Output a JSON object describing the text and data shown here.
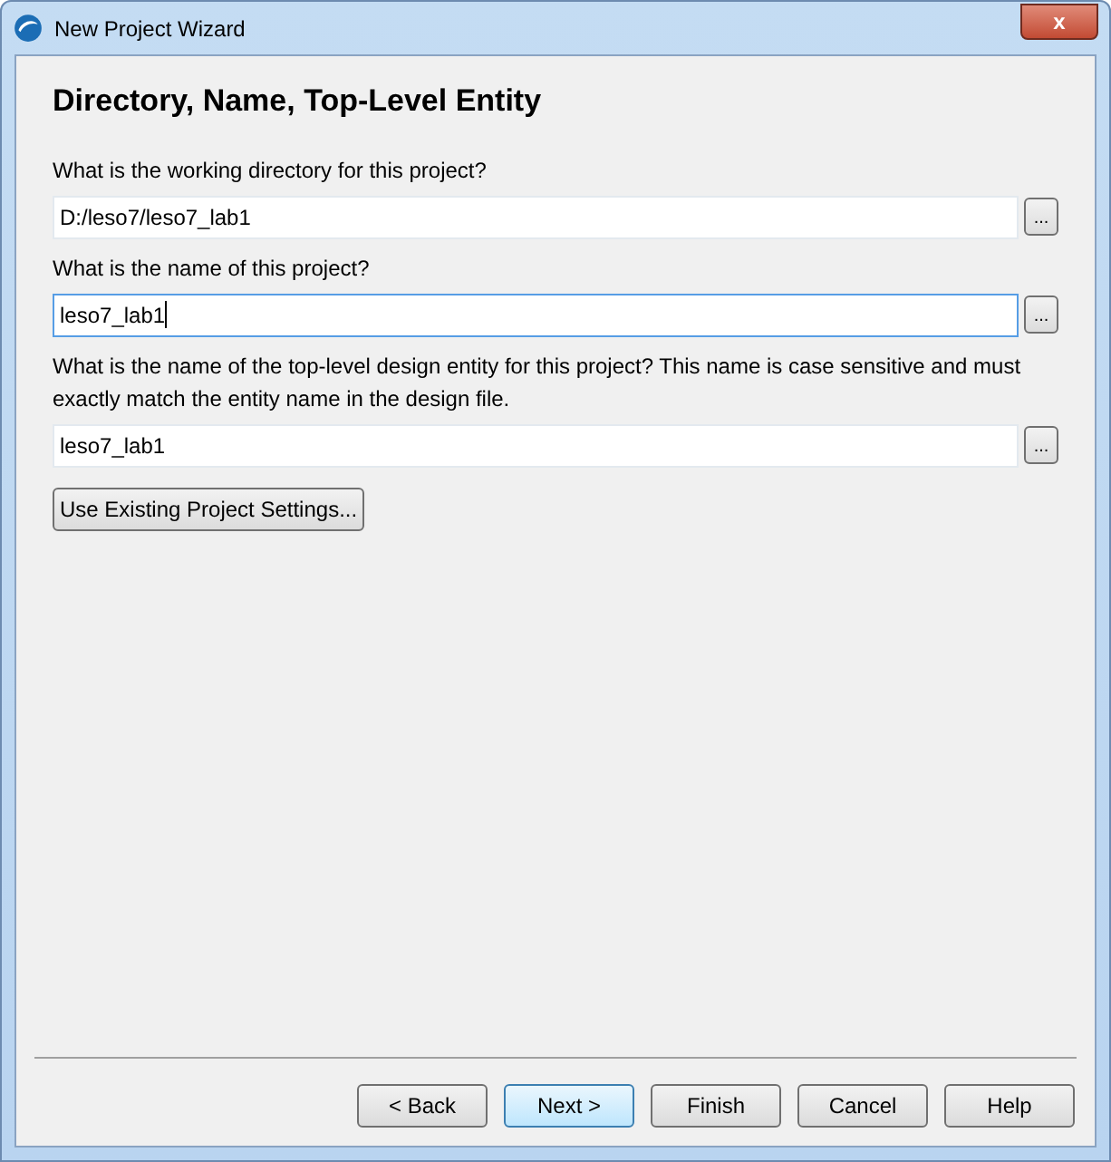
{
  "window": {
    "title": "New Project Wizard",
    "close_label": "x"
  },
  "heading": "Directory, Name, Top-Level Entity",
  "fields": [
    {
      "label": "What is the working directory for this project?",
      "value": "D:/leso7/leso7_lab1",
      "focused": false,
      "browse": "..."
    },
    {
      "label": "What is the name of this project?",
      "value": "leso7_lab1",
      "focused": true,
      "browse": "..."
    },
    {
      "label": "What is the name of the top-level design entity for this project? This name is case sensitive and must exactly match the entity name in the design file.",
      "value": "leso7_lab1",
      "focused": false,
      "browse": "..."
    }
  ],
  "settings_button": {
    "label": "Use Existing Project Settings..."
  },
  "buttons": [
    {
      "label": "< Back",
      "default": false
    },
    {
      "label": "Next >",
      "default": true
    },
    {
      "label": "Finish",
      "default": false
    },
    {
      "label": "Cancel",
      "default": false
    },
    {
      "label": "Help",
      "default": false
    }
  ]
}
